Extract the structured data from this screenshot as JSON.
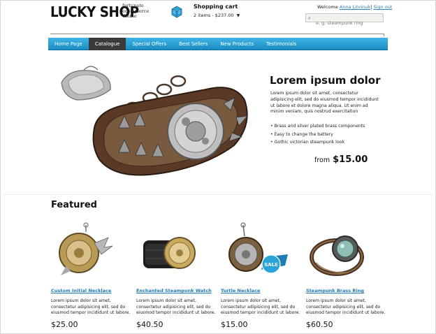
{
  "header": {
    "logo": "LUCKY SHOP",
    "tagline": [
      "fortunate",
      "ecommerce",
      "theme"
    ],
    "cart_title": "Shopping cart",
    "cart_summary": "2 items - $237.00",
    "welcome_prefix": "Welcome",
    "user_name": "Anna Litvinuk",
    "separator": "|",
    "sign_out": "Sign out",
    "search_placeholder": "e. g. steampunk ring"
  },
  "nav": {
    "items": [
      {
        "label": "Home Page",
        "active": false
      },
      {
        "label": "Catalogue",
        "active": true
      },
      {
        "label": "Special Offers",
        "active": false
      },
      {
        "label": "Best Sellers",
        "active": false
      },
      {
        "label": "New Products",
        "active": false
      },
      {
        "label": "Testimonials",
        "active": false
      }
    ],
    "accent": "#2a9fd6",
    "active_bg": "#3a3a3a"
  },
  "hero": {
    "title": "Lorem ipsum dolor",
    "description": "Lorem ipsum dolor sit amet, consectetur adipisicing elit, sed do eiusmod tempor incididunt ut labore et dolore magna aliqua. Ut enim ad minim veniam, quis nostrud exercitation",
    "bullets": [
      "Brass and silver plated brass components",
      "Easy to change the battery",
      "Gothic victorian steampunk look"
    ],
    "price_prefix": "from",
    "price": "$15.00"
  },
  "featured": {
    "title": "Featured",
    "products": [
      {
        "name": "Custom Initial Necklace",
        "description": "Lorem ipsum dolor sit amet, consectetur adipisicing elit, sed do eiusmod tempor incididunt ut labore.",
        "price": "$25.00"
      },
      {
        "name": "Enchanted Steampunk Watch",
        "description": "Lorem ipsum dolor sit amet, consectetur adipisicing elit, sed do eiusmod tempor incididunt ut labore.",
        "price": "$40.50"
      },
      {
        "name": "Turtle Necklace",
        "description": "Lorem ipsum dolor sit amet, consectetur adipisicing elit, sed do eiusmod tempor incididunt ut labore.",
        "price": "$15.00",
        "badge": "SALE"
      },
      {
        "name": "Steampunk Brass Ring",
        "description": "Lorem ipsum dolor sit amet, consectetur adipisicing elit, sed do eiusmod tempor incididunt ut labore.",
        "price": "$60.50"
      }
    ]
  },
  "icons": {
    "cart": "shopping-cart-icon",
    "search": "search-icon",
    "caret": "caret-down-icon"
  },
  "colors": {
    "link": "#1f7ab6",
    "sale_badge": "#2aa3d8"
  }
}
